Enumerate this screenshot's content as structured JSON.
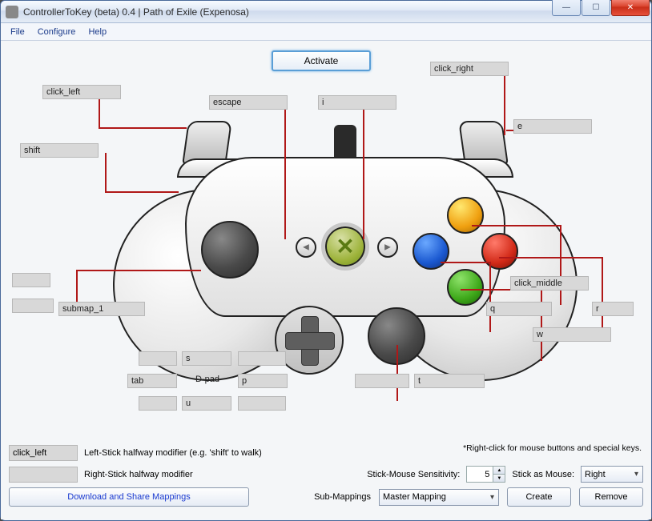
{
  "window": {
    "title": "ControllerToKey (beta) 0.4 | Path of Exile (Expenosa)"
  },
  "menu": {
    "file": "File",
    "configure": "Configure",
    "help": "Help"
  },
  "activate_label": "Activate",
  "mappings": {
    "left_trigger": "click_left",
    "right_trigger": "click_right",
    "left_bumper": "shift",
    "right_bumper": "e",
    "back": "escape",
    "start": "i",
    "y": "click_middle",
    "x": "q",
    "b": "r",
    "a": "w",
    "left_stick_click": "submap_1",
    "left_stick_other": "",
    "right_stick_click": "t",
    "right_stick_other": "",
    "dpad_up": "",
    "dpad_down": "u",
    "dpad_left": "tab",
    "dpad_right": "p",
    "dpad_extra": "s"
  },
  "dpad_label": "D-pad",
  "footer": {
    "left_stick_mod_value": "click_left",
    "left_stick_mod_label": "Left-Stick halfway modifier (e.g. 'shift' to walk)",
    "right_stick_mod_value": "",
    "right_stick_mod_label": "Right-Stick halfway modifier",
    "hint": "*Right-click for mouse buttons and special keys.",
    "sensitivity_label": "Stick-Mouse Sensitivity:",
    "sensitivity_value": "5",
    "stick_as_mouse_label": "Stick as Mouse:",
    "stick_as_mouse_value": "Right",
    "download_label": "Download and Share Mappings",
    "submappings_label": "Sub-Mappings",
    "submappings_value": "Master Mapping",
    "create_label": "Create",
    "remove_label": "Remove"
  }
}
